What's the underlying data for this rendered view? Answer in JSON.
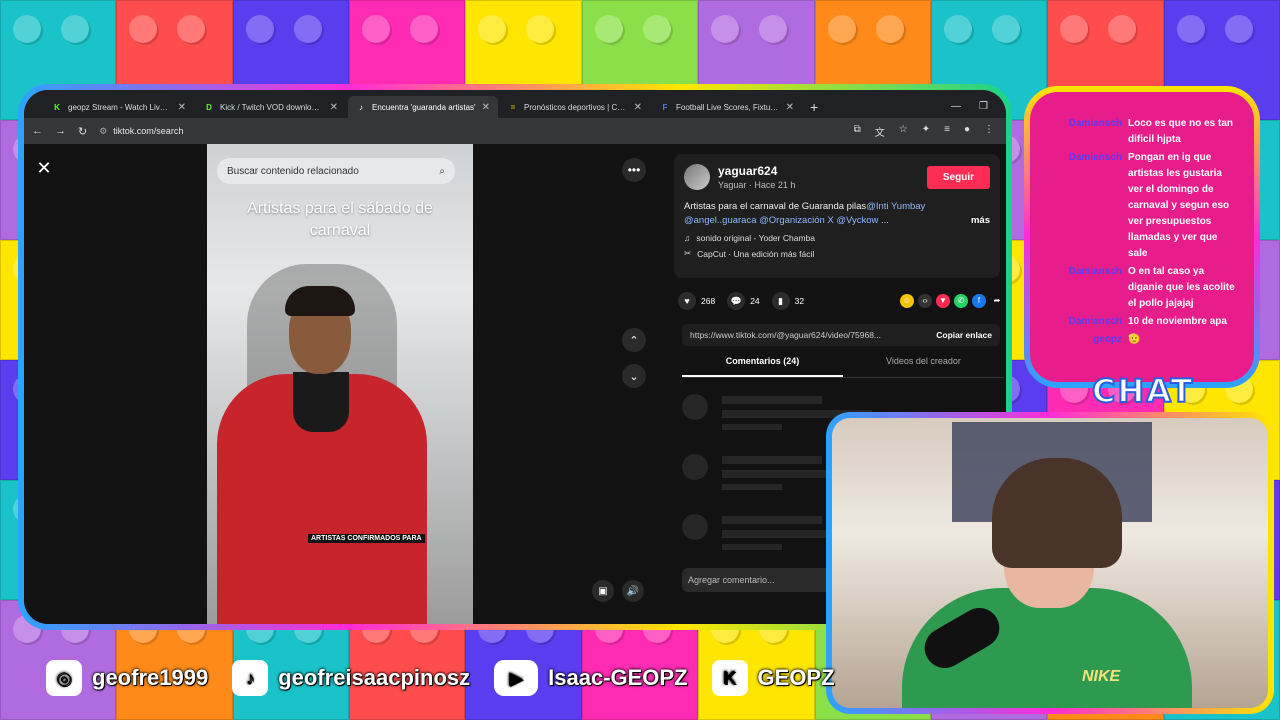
{
  "browser": {
    "tabs": [
      {
        "title": "geopz Stream - Watch Live on",
        "favicon": "kick-icon",
        "color": "#53fc18",
        "glyph": "K"
      },
      {
        "title": "Kick / Twitch VOD downloader",
        "favicon": "d-icon",
        "color": "#53fc18",
        "glyph": "D"
      },
      {
        "title": "Encuentra 'guaranda artistas'",
        "favicon": "tiktok-icon",
        "color": "#ffffff",
        "glyph": "♪"
      },
      {
        "title": "Pronósticos deportivos | Casin",
        "favicon": "dash-icon",
        "color": "#d4b106",
        "glyph": "="
      },
      {
        "title": "Football Live Scores, Fixtures &",
        "favicon": "football-icon",
        "color": "#3b82f6",
        "glyph": "F"
      }
    ],
    "url": "tiktok.com/search"
  },
  "video": {
    "search_placeholder": "Buscar contenido relacionado",
    "title": "Artistas para el sábado de carnaval",
    "caption": "ARTISTAS CONFIRMADOS PARA"
  },
  "post": {
    "author": "yaguar624",
    "author_sub": "Yaguar · Hace 21 h",
    "follow": "Seguir",
    "desc_text": "Artistas para el carnaval de Guaranda pilas",
    "desc_tag1": "@Inti Yumbay",
    "desc_tags2": "@angel..guaraca @Organización X @Vyckow ...",
    "more": "más",
    "sound": "sonido original - Yoder Chamba",
    "capcut": "CapCut · Una edición más fácil",
    "likes": "268",
    "comments": "24",
    "saves": "32",
    "link": "https://www.tiktok.com/@yaguar624/video/75968...",
    "copy": "Copiar enlace",
    "tab_comments": "Comentarios (24)",
    "tab_videos": "Videos del creador",
    "comment_placeholder": "Agregar comentario..."
  },
  "chat": {
    "label": "CHAT",
    "messages": [
      {
        "user": "Damiansch",
        "text": "Loco es que no es tan dificil hjpta"
      },
      {
        "user": "Damiansch",
        "text": "Pongan en ig que artistas les gustaria ver el domingo de carnaval y segun eso ver presupuestos llamadas y ver que sale"
      },
      {
        "user": "Damiansch",
        "text": "O en tal caso ya diganie que les acolite el pollo jajajaj"
      },
      {
        "user": "Damiansch",
        "text": "10 de noviembre apa"
      },
      {
        "user": "geopz",
        "text": "🫡"
      }
    ]
  },
  "socials": [
    {
      "icon": "instagram-icon",
      "handle": "geofre1999"
    },
    {
      "icon": "tiktok-icon",
      "handle": "geofreisaacpinosz"
    },
    {
      "icon": "youtube-icon",
      "handle": "Isaac-GEOPZ"
    },
    {
      "icon": "kick-icon",
      "handle": "GEOPZ"
    }
  ],
  "colors": {
    "follow_button": "#fe2c55",
    "chat_bg": "#e81d8c",
    "chat_user": "#5b3df0"
  },
  "cam": {
    "shirt_logo": "NIKE"
  }
}
